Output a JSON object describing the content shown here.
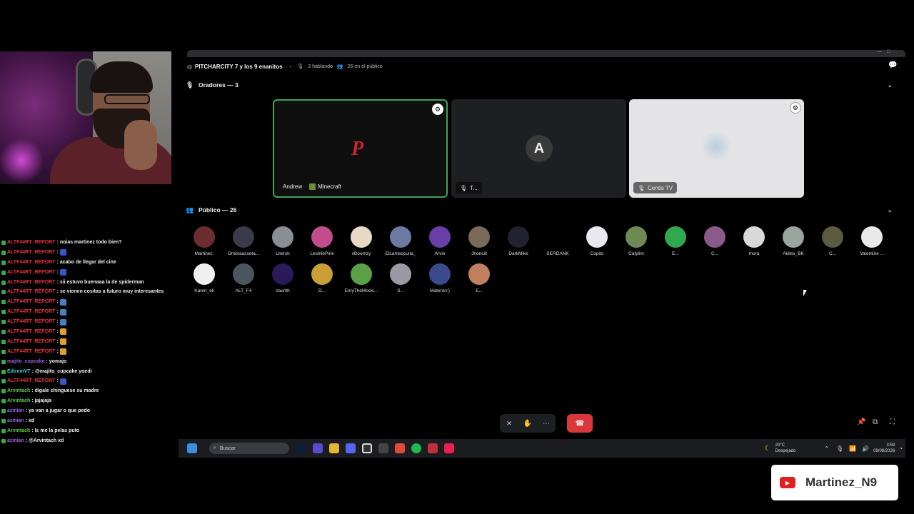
{
  "channel": {
    "title": "PITCHARCITY 7 y los 9 enanitos",
    "speaking": "3 hablando",
    "audience_count": "26 en el público"
  },
  "speakers_section": {
    "label": "Oradores — 3"
  },
  "audience_section": {
    "label": "Público — 26"
  },
  "speakers": [
    {
      "name": "Andrew",
      "activity": "Minecraft"
    },
    {
      "name": "T..."
    },
    {
      "name": "Centis TV"
    }
  ],
  "audience": [
    {
      "name": "Martinez.",
      "color": "#6b2d2d"
    },
    {
      "name": "Ombraasseta...",
      "color": "#3a3a4a"
    },
    {
      "name": "Litersh",
      "color": "#8a8f96"
    },
    {
      "name": "LeshliePink",
      "color": "#c24d8d"
    },
    {
      "name": "vBoomzy",
      "color": "#e8d9c6"
    },
    {
      "name": "ElLameqcuita_",
      "color": "#6c7aa3"
    },
    {
      "name": "Arvin",
      "color": "#6a3ea8"
    },
    {
      "name": "Jhoncill",
      "color": "#7a6a5a"
    },
    {
      "name": "DarkMike",
      "color": "#222233"
    },
    {
      "name": "SERDANK",
      "color": "#000000"
    },
    {
      "name": "Copito",
      "color": "#e8e8ee"
    },
    {
      "name": "Catylim",
      "color": "#6d8a55"
    },
    {
      "name": "E...",
      "color": "#2fa84f"
    },
    {
      "name": "C...",
      "color": "#8a5a8a"
    },
    {
      "name": "mora",
      "color": "#d9d9d9"
    },
    {
      "name": "Akiles_BK",
      "color": "#9aa5a0"
    },
    {
      "name": "C...",
      "color": "#5a5a40"
    },
    {
      "name": "Valentine ...",
      "color": "#e8e8e8"
    },
    {
      "name": "Karen_eli",
      "color": "#f0f0f0"
    },
    {
      "name": "ALT_F4",
      "color": "#4a5560"
    },
    {
      "name": "zaurith",
      "color": "#2a1a5a"
    },
    {
      "name": "D...",
      "color": "#c9a035"
    },
    {
      "name": "EmyTheMocki...",
      "color": "#5aa046"
    },
    {
      "name": "S...",
      "color": "#9a9aa6"
    },
    {
      "name": "Materón:)",
      "color": "#3a4a8a"
    },
    {
      "name": "E...",
      "color": "#c08060"
    }
  ],
  "chat": [
    {
      "user": "ALTF44RT_REPORT",
      "msg": ": noias martinez todo bien?",
      "color": "#e8343f"
    },
    {
      "user": "ALTF44RT_REPORT",
      "msg": ":",
      "color": "#e8343f",
      "emote": "#3a57c7"
    },
    {
      "user": "ALTF44RT_REPORT",
      "msg": ": acabo de llegar del cine",
      "color": "#e8343f"
    },
    {
      "user": "ALTF44RT_REPORT",
      "msg": ":",
      "color": "#e8343f",
      "emote": "#3a57c7"
    },
    {
      "user": "ALTF44RT_REPORT",
      "msg": ": sii estuvo buenaaa la de spiderman",
      "color": "#e8343f"
    },
    {
      "user": "ALTF44RT_REPORT",
      "msg": ": se vienen cositas a futuro muy interesantes",
      "color": "#e8343f"
    },
    {
      "user": "ALTF44RT_REPORT",
      "msg": ":",
      "color": "#e8343f",
      "emote": "#4a80c0"
    },
    {
      "user": "ALTF44RT_REPORT",
      "msg": ":",
      "color": "#e8343f",
      "emote": "#4a80c0"
    },
    {
      "user": "ALTF44RT_REPORT",
      "msg": ":",
      "color": "#e8343f",
      "emote": "#4a80c0"
    },
    {
      "user": "ALTF44RT_REPORT",
      "msg": ":",
      "color": "#e8343f",
      "emote": "#e0a030"
    },
    {
      "user": "ALTF44RT_REPORT",
      "msg": ":",
      "color": "#e8343f",
      "emote": "#e0a030"
    },
    {
      "user": "ALTF44RT_REPORT",
      "msg": ":",
      "color": "#e8343f",
      "emote": "#e0a030"
    },
    {
      "user": "majito_cupcake",
      "msg": ": yomajo",
      "color": "#a45ce0"
    },
    {
      "user": "EdiremVT",
      "msg": ": @majito_cupcake yoedi",
      "color": "#3ccfd0"
    },
    {
      "user": "ALTF44RT_REPORT",
      "msg": ":",
      "color": "#e8343f",
      "emote": "#3a57c7"
    },
    {
      "user": "Arvintach",
      "msg": ": digale chinguese su madre",
      "color": "#5ad04a"
    },
    {
      "user": "Arvintach",
      "msg": ": jajajaja",
      "color": "#5ad04a"
    },
    {
      "user": "azmian",
      "msg": ": ya van a jugar o que pedo",
      "color": "#a45ce0"
    },
    {
      "user": "azmian",
      "msg": ": xd",
      "color": "#a45ce0"
    },
    {
      "user": "Arvintach",
      "msg": ": Is me la pelas puto",
      "color": "#5ad04a"
    },
    {
      "user": "azmian",
      "msg": ": @Arvintach xd",
      "color": "#a45ce0"
    }
  ],
  "taskbar": {
    "search_placeholder": "Buscar",
    "weather_temp": "20°C",
    "weather_desc": "Despejado",
    "time": "3:59",
    "date": "09/08/2026"
  },
  "streamer_badge": {
    "name": "Martinez_N9"
  },
  "colors": {
    "accent_green": "#3ba55c",
    "leave_red": "#da373c",
    "discord_bg": "#000000"
  }
}
